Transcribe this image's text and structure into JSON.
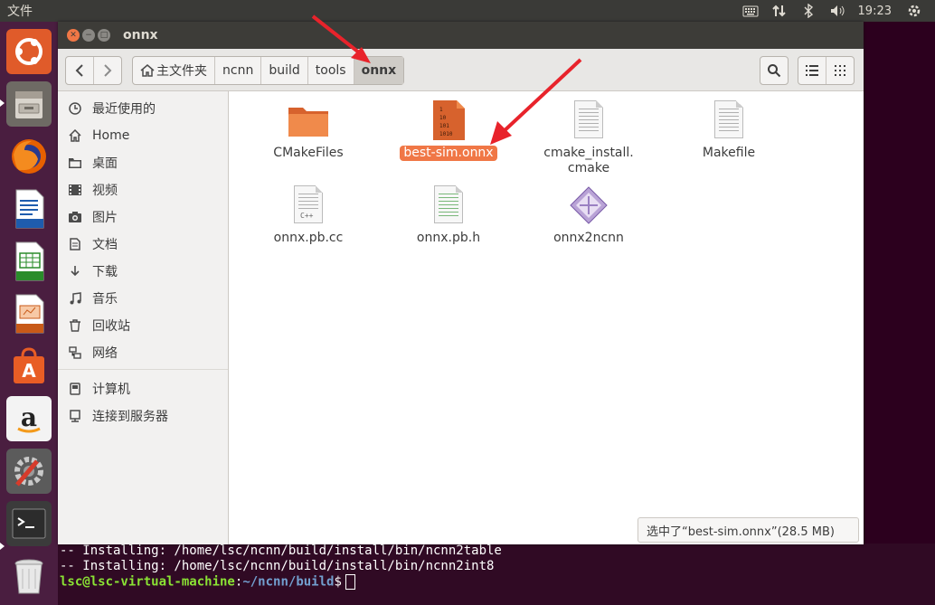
{
  "top_panel": {
    "app_menu": "文件",
    "clock": "19:23"
  },
  "window": {
    "title": "onnx"
  },
  "breadcrumbs": [
    {
      "label": "主文件夹",
      "home": true
    },
    {
      "label": "ncnn"
    },
    {
      "label": "build"
    },
    {
      "label": "tools"
    },
    {
      "label": "onnx",
      "active": true
    }
  ],
  "sidebar": {
    "items": [
      {
        "label": "最近使用的",
        "icon": "clock-icon"
      },
      {
        "label": "Home",
        "icon": "home-icon"
      },
      {
        "label": "桌面",
        "icon": "folder-icon"
      },
      {
        "label": "视频",
        "icon": "video-icon"
      },
      {
        "label": "图片",
        "icon": "camera-icon"
      },
      {
        "label": "文档",
        "icon": "document-icon"
      },
      {
        "label": "下载",
        "icon": "download-icon"
      },
      {
        "label": "音乐",
        "icon": "music-icon"
      },
      {
        "label": "回收站",
        "icon": "trash-icon"
      },
      {
        "label": "网络",
        "icon": "network-icon"
      }
    ],
    "devices": [
      {
        "label": "计算机",
        "icon": "computer-icon"
      },
      {
        "label": "连接到服务器",
        "icon": "server-icon"
      }
    ]
  },
  "files": [
    {
      "name": "CMakeFiles",
      "icon": "folder-icon"
    },
    {
      "name": "best-sim.onnx",
      "icon": "binary-file-icon",
      "selected": true
    },
    {
      "name_line1": "cmake_install.",
      "name_line2": "cmake",
      "icon": "text-file-icon"
    },
    {
      "name": "Makefile",
      "icon": "text-file-icon"
    },
    {
      "name": "onnx.pb.cc",
      "icon": "cpp-file-icon",
      "tag": "C++"
    },
    {
      "name": "onnx.pb.h",
      "icon": "header-file-icon"
    },
    {
      "name": "onnx2ncnn",
      "icon": "executable-icon"
    }
  ],
  "binary_icon_text": [
    "1",
    "10",
    "101",
    "1010"
  ],
  "status_text": "选中了“best-sim.onnx”(28.5 MB)",
  "terminal": {
    "lines": [
      "-- Installing: /home/lsc/ncnn/build/install/bin/ncnn2table",
      "-- Installing: /home/lsc/ncnn/build/install/bin/ncnn2int8"
    ],
    "prompt_user": "lsc@lsc-virtual-machine",
    "prompt_sep": ":",
    "prompt_path": "~/ncnn/build",
    "prompt_end": "$"
  },
  "colors": {
    "accent": "#f07746",
    "launcher": "#4a1e40",
    "terminal_bg": "#300a24",
    "arrow": "#e8232b"
  }
}
